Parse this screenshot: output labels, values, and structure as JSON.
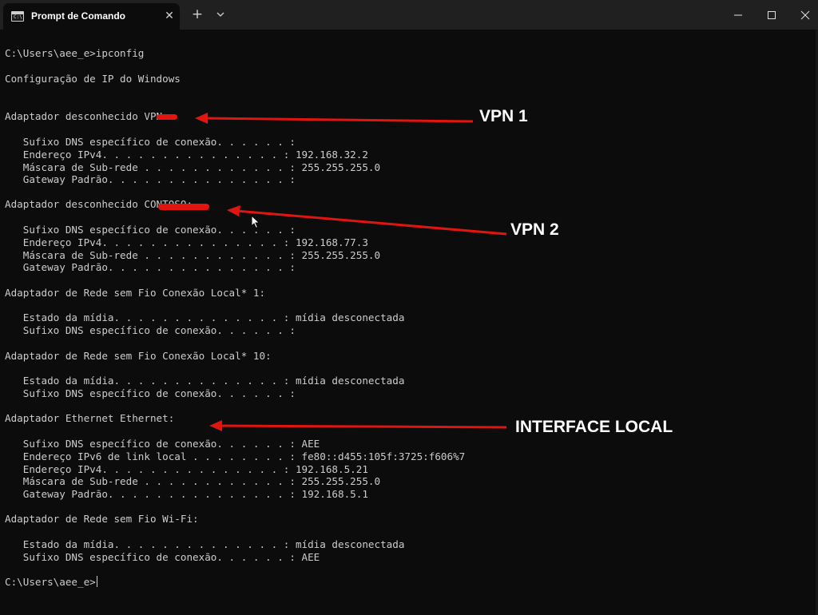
{
  "window": {
    "tab_title": "Prompt de Comando",
    "tab_close_glyph": "✕",
    "new_tab_glyph": "+",
    "accent_color": "#e0150f",
    "background_color": "#0c0c0c",
    "text_color": "#cccccc"
  },
  "console": {
    "lines": [
      "C:\\Users\\aee_e>ipconfig",
      "Configuração de IP do Windows",
      "Adaptador desconhecido VPN:",
      "   Sufixo DNS específico de conexão. . . . . . :",
      "   Endereço IPv4. . . . . . . . . . . . . . . : 192.168.32.2",
      "   Máscara de Sub-rede . . . . . . . . . . . . : 255.255.255.0",
      "   Gateway Padrão. . . . . . . . . . . . . . . :",
      "Adaptador desconhecido CONTOSO:",
      "   Sufixo DNS específico de conexão. . . . . . :",
      "   Endereço IPv4. . . . . . . . . . . . . . . : 192.168.77.3",
      "   Máscara de Sub-rede . . . . . . . . . . . . : 255.255.255.0",
      "   Gateway Padrão. . . . . . . . . . . . . . . :",
      "Adaptador de Rede sem Fio Conexão Local* 1:",
      "   Estado da mídia. . . . . . . . . . . . . . : mídia desconectada",
      "   Sufixo DNS específico de conexão. . . . . . :",
      "Adaptador de Rede sem Fio Conexão Local* 10:",
      "   Estado da mídia. . . . . . . . . . . . . . : mídia desconectada",
      "   Sufixo DNS específico de conexão. . . . . . :",
      "Adaptador Ethernet Ethernet:",
      "   Sufixo DNS específico de conexão. . . . . . : AEE",
      "   Endereço IPv6 de link local . . . . . . . . : fe80::d455:105f:3725:f606%7",
      "   Endereço IPv4. . . . . . . . . . . . . . . : 192.168.5.21",
      "   Máscara de Sub-rede . . . . . . . . . . . . : 255.255.255.0",
      "   Gateway Padrão. . . . . . . . . . . . . . . : 192.168.5.1",
      "Adaptador de Rede sem Fio Wi-Fi:",
      "   Estado da mídia. . . . . . . . . . . . . . : mídia desconectada",
      "   Sufixo DNS específico de conexão. . . . . . : AEE",
      "C:\\Users\\aee_e>"
    ]
  },
  "annotations": {
    "vpn1": "VPN 1",
    "vpn2": "VPN 2",
    "interface_local": "INTERFACE LOCAL"
  }
}
